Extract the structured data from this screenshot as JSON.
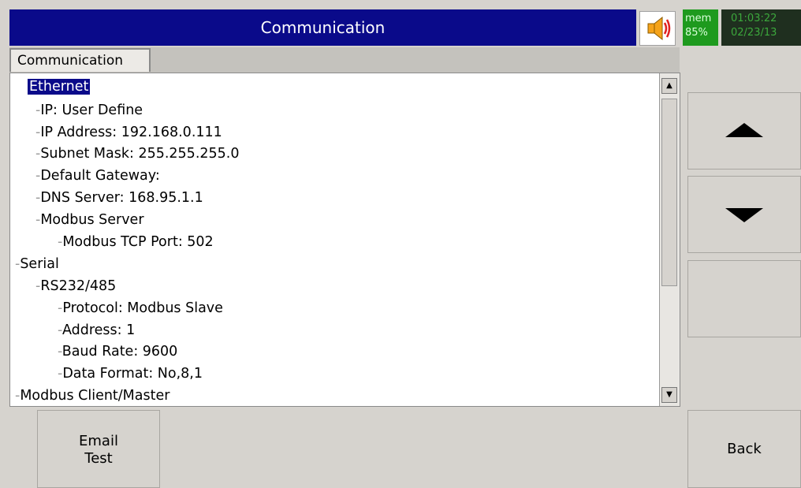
{
  "header": {
    "title": "Communication",
    "speaker_icon": "speaker-icon",
    "mem_label": "mem",
    "mem_value": "85%",
    "time": "01:03:22",
    "date": "02/23/13"
  },
  "tab": {
    "label": "Communication"
  },
  "tree": {
    "items": [
      {
        "label": "Ethernet",
        "selected": true
      },
      {
        "label": "IP: User Define"
      },
      {
        "label": "IP Address: 192.168.0.111"
      },
      {
        "label": "Subnet Mask: 255.255.255.0"
      },
      {
        "label": "Default Gateway:"
      },
      {
        "label": "DNS Server: 168.95.1.1"
      },
      {
        "label": "Modbus Server"
      },
      {
        "label": "Modbus TCP Port: 502"
      },
      {
        "label": "Serial"
      },
      {
        "label": "RS232/485"
      },
      {
        "label": "Protocol: Modbus Slave"
      },
      {
        "label": "Address: 1"
      },
      {
        "label": "Baud Rate: 9600"
      },
      {
        "label": "Data Format: No,8,1"
      },
      {
        "label": "Modbus Client/Master"
      }
    ]
  },
  "side_buttons": {
    "up_icon": "arrow-up-icon",
    "down_icon": "arrow-down-icon"
  },
  "bottom": {
    "email_line1": "Email",
    "email_line2": "Test",
    "back": "Back"
  }
}
